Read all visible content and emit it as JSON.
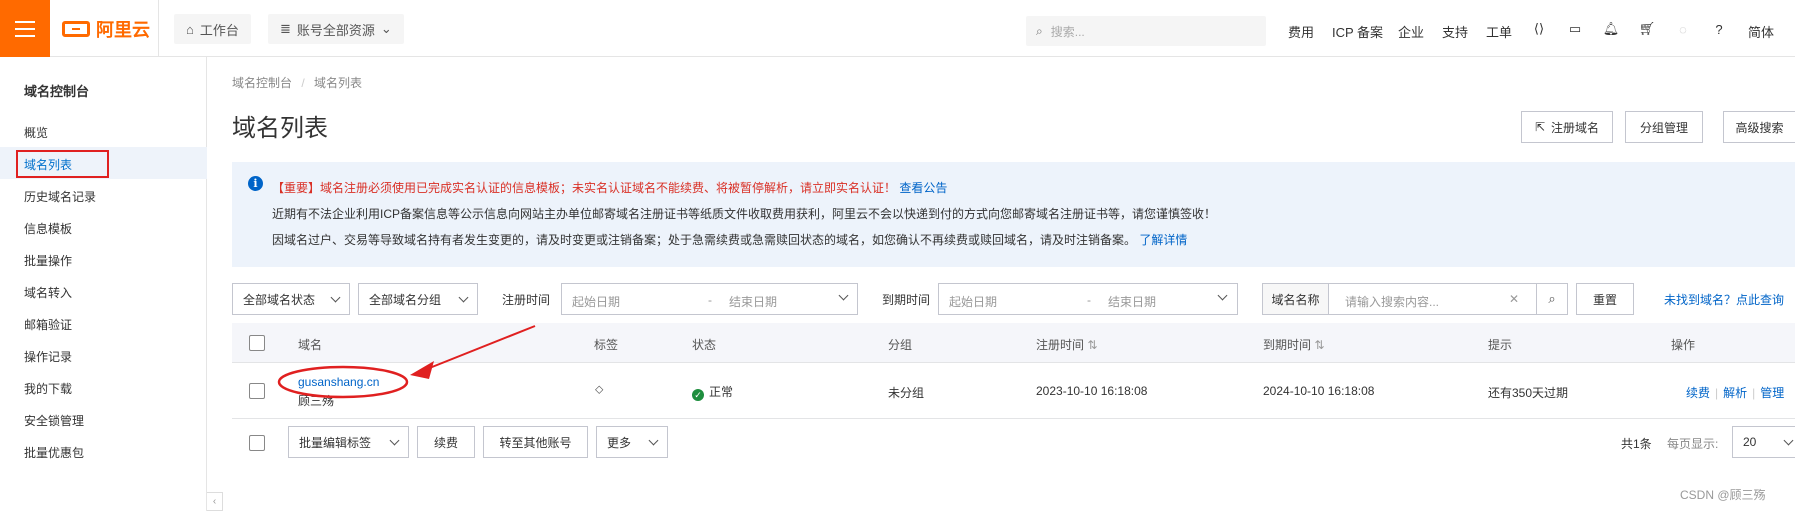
{
  "topbar": {
    "brand": "阿里云",
    "workbench": "工作台",
    "account_scope": "账号全部资源",
    "search_placeholder": "搜索...",
    "links": [
      "费用",
      "ICP 备案",
      "企业",
      "支持",
      "工单"
    ],
    "lang": "简体"
  },
  "sidebar": {
    "title": "域名控制台",
    "items": [
      "概览",
      "域名列表",
      "历史域名记录",
      "信息模板",
      "批量操作",
      "域名转入",
      "邮箱验证",
      "操作记录",
      "我的下载",
      "安全锁管理",
      "批量优惠包"
    ],
    "active_index": 1
  },
  "breadcrumb": {
    "root": "域名控制台",
    "sep": "/",
    "current": "域名列表"
  },
  "page_title": "域名列表",
  "header_buttons": {
    "register": "注册域名",
    "group_manage": "分组管理",
    "advanced_search": "高级搜索"
  },
  "notice": {
    "line1_red": "【重要】域名注册必须使用已完成实名认证的信息模板；未实名认证域名不能续费、将被暂停解析，请立即实名认证！",
    "line1_link": "查看公告",
    "line2": "近期有不法企业利用ICP备案信息等公示信息向网站主办单位邮寄域名注册证书等纸质文件收取费用获利，阿里云不会以快递到付的方式向您邮寄域名注册证书等，请您谨慎签收！",
    "line3": "因域名过户、交易等导致域名持有者发生变更的，请及时变更或注销备案；处于急需续费或急需赎回状态的域名，如您确认不再续费或赎回域名，请及时注销备案。",
    "line3_link": "了解详情"
  },
  "filters": {
    "status": "全部域名状态",
    "group": "全部域名分组",
    "reg_time_label": "注册时间",
    "expire_time_label": "到期时间",
    "start_date": "起始日期",
    "range_sep": "-",
    "end_date": "结束日期",
    "search_key": "域名名称",
    "search_placeholder": "请输入搜索内容...",
    "reset": "重置",
    "not_found": "未找到域名？点此查询"
  },
  "table": {
    "headers": [
      "域名",
      "标签",
      "状态",
      "分组",
      "注册时间",
      "到期时间",
      "提示",
      "操作"
    ],
    "rows": [
      {
        "domain": "gusanshang.cn",
        "owner": "顾三殇",
        "status": "正常",
        "group": "未分组",
        "reg_time": "2023-10-10 16:18:08",
        "expire_time": "2024-10-10 16:18:08",
        "hint": "还有350天过期",
        "ops": [
          "续费",
          "解析",
          "管理"
        ]
      }
    ]
  },
  "footer": {
    "batch_tag": "批量编辑标签",
    "renew": "续费",
    "transfer": "转至其他账号",
    "more": "更多",
    "total": "共1条",
    "page_size_label": "每页显示:",
    "page_size": "20"
  },
  "watermark": "CSDN @顾三殇",
  "colors": {
    "brand": "#ff6a00",
    "link": "#0064c8",
    "annotation": "#e02020"
  }
}
